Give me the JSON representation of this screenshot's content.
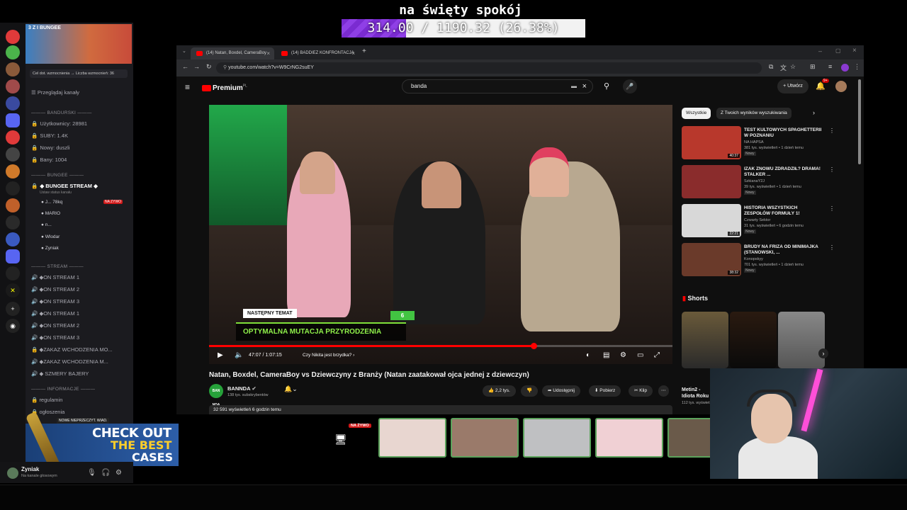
{
  "goal": {
    "title": "na święty spokój",
    "progress_text": "314.00 / 1190.32 (26.38%)",
    "progress_fraction": 0.2638,
    "fill_color": "#8f3fe6"
  },
  "discord": {
    "server_banner_name": "3 Z I BUNGEE",
    "boost_text": "Cel dot. wzmocnienia → Liczba wzmocnień: 36",
    "browse_channels": "Przeglądaj kanały",
    "categories": {
      "bandurski": "BANDURSKI",
      "bungee": "BUNGEE",
      "stream": "STREAM",
      "informacje": "INFORMACJE"
    },
    "stat_channels": [
      "Użytkownicy: 28981",
      "SUBY: 1.4K",
      "Nowy: duszli",
      "Bany: 1004"
    ],
    "bungee_stream": "BUNGEE STREAM",
    "bungee_stream_status": "Ustaw status kanału",
    "voice_users": [
      "J...",
      "MARIO",
      "n...",
      "Wlodar",
      "Zyniak"
    ],
    "voice_user_extra": "78kq",
    "live_badge": "NA ŻYWO",
    "stream_channels": [
      "ON STREAM 1",
      "ON STREAM 2",
      "ON STREAM 3",
      "ON STREAM 1",
      "ON STREAM 2",
      "ON STREAM 3",
      "ZAKAZ WCHODZENIA MO...",
      "ZAKAZ WCHODZENIA M...",
      "SZMERY BAJERY"
    ],
    "info_channels": [
      "regulamin",
      "ogłoszenia"
    ],
    "user_name": "Zyniak",
    "user_status": "Na kanale głosowym",
    "new_unread": "NOWE NIEPRZECZYT. WIAD."
  },
  "ad": {
    "line1": "CHECK OUT",
    "line2": "THE BEST",
    "line3": "CASES"
  },
  "browser": {
    "tabs": [
      "(14) Natan, Boxdel, CameraBoy",
      "(14) BADDIEZ KONFRONTACJA"
    ],
    "url": "youtube.com/watch?v=W9CrNG2suEY"
  },
  "youtube": {
    "logo_text": "Premium",
    "logo_region": "PL",
    "search_query": "banda",
    "create_label": "Utwórz",
    "bell_badge": "9+",
    "player": {
      "lower_third_tag": "NASTĘPNY TEMAT",
      "lower_third_text": "OPTYMALNA MUTACJA PRZYRODZENIA",
      "lower_third_number": "6",
      "time": "47:07 / 1:07:15",
      "chapter": "Czy Nikita jest brzydka? ›",
      "progress_fraction": 0.7
    },
    "video_title": "Natan, Boxdel, CameraBoy vs Dziewczyny z Branży (Natan zaatakował ojca jednej z dziewczyn)",
    "channel_name": "BANNDA",
    "channel_avatar_text": "BAN NDA",
    "channel_subs": "138 tys. subskrybentów",
    "like_count": "2,2 tys.",
    "share_label": "Udostępnij",
    "download_label": "Pobierz",
    "clip_label": "Klip",
    "views_line": "32 591 wyświetleń  6 godzin temu",
    "chips": [
      "Wszystkie",
      "Z Twoich wyników wyszukiwania"
    ],
    "recommendations": [
      {
        "title": "TEST KULTOWYCH SPAGHETTERII W POZNANIU",
        "channel": "NA HAPSA",
        "meta": "381 tys. wyświetleń • 1 dzień temu",
        "duration": "40:37",
        "badge": "Nowy",
        "color": "#b8382c"
      },
      {
        "title": "IZAK ZNOWU ZDRADZIŁ? DRAMA! STALKER ...",
        "channel": "SzkianaY2J",
        "meta": "39 tys. wyświetleń • 1 dzień temu",
        "duration": "",
        "badge": "Nowy",
        "color": "#8a2c2c"
      },
      {
        "title": "HISTORIA WSZYSTKICH ZESPOŁÓW FORMUŁY 1!",
        "channel": "Czwarty Sektor",
        "meta": "31 tys. wyświetleń • 6 godzin temu",
        "duration": "22:21",
        "badge": "Nowy",
        "color": "#d8d8d8"
      },
      {
        "title": "BRUDY NA FRIZA OD MINIMAJKA (STANOWSKI, ...",
        "channel": "Konopskyy",
        "meta": "701 tys. wyświetleń • 1 dzień temu",
        "duration": "38:32",
        "badge": "Nowy",
        "color": "#6a3a2a"
      }
    ],
    "shorts_label": "Shorts",
    "short1_caption": "Metin2 - Idiota Roku",
    "short1_meta": "112 tys. wyświetleń"
  },
  "tiles": {
    "live_badge": "NA ŻYWO"
  }
}
